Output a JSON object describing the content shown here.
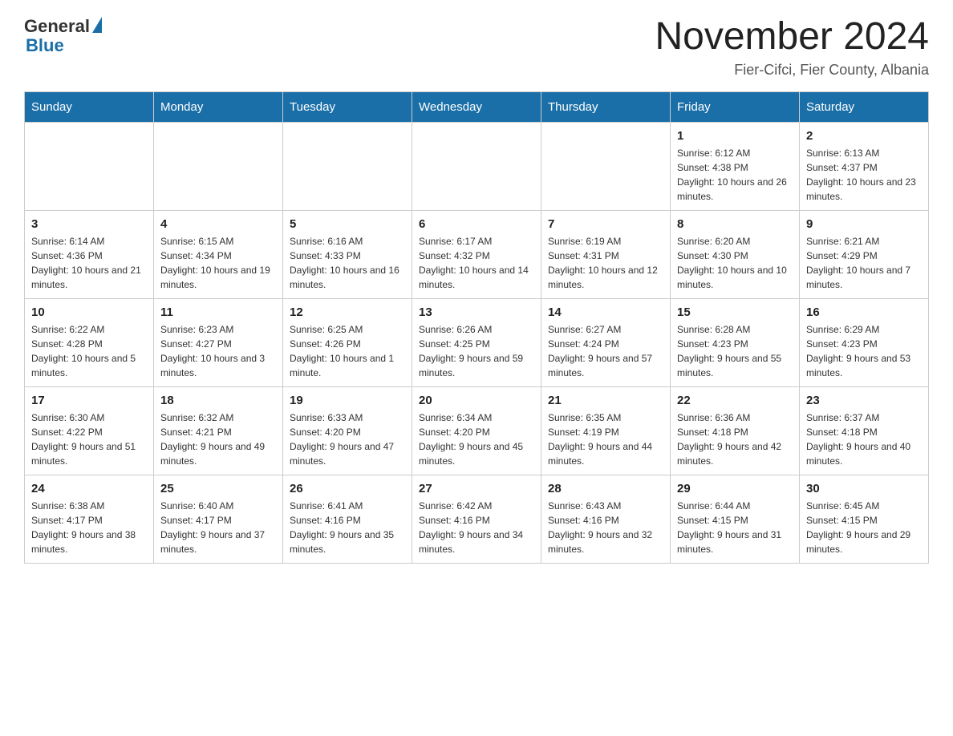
{
  "header": {
    "logo": {
      "general": "General",
      "blue": "Blue"
    },
    "title": "November 2024",
    "location": "Fier-Cifci, Fier County, Albania"
  },
  "calendar": {
    "days_of_week": [
      "Sunday",
      "Monday",
      "Tuesday",
      "Wednesday",
      "Thursday",
      "Friday",
      "Saturday"
    ],
    "weeks": [
      [
        {
          "day": "",
          "info": ""
        },
        {
          "day": "",
          "info": ""
        },
        {
          "day": "",
          "info": ""
        },
        {
          "day": "",
          "info": ""
        },
        {
          "day": "",
          "info": ""
        },
        {
          "day": "1",
          "info": "Sunrise: 6:12 AM\nSunset: 4:38 PM\nDaylight: 10 hours and 26 minutes."
        },
        {
          "day": "2",
          "info": "Sunrise: 6:13 AM\nSunset: 4:37 PM\nDaylight: 10 hours and 23 minutes."
        }
      ],
      [
        {
          "day": "3",
          "info": "Sunrise: 6:14 AM\nSunset: 4:36 PM\nDaylight: 10 hours and 21 minutes."
        },
        {
          "day": "4",
          "info": "Sunrise: 6:15 AM\nSunset: 4:34 PM\nDaylight: 10 hours and 19 minutes."
        },
        {
          "day": "5",
          "info": "Sunrise: 6:16 AM\nSunset: 4:33 PM\nDaylight: 10 hours and 16 minutes."
        },
        {
          "day": "6",
          "info": "Sunrise: 6:17 AM\nSunset: 4:32 PM\nDaylight: 10 hours and 14 minutes."
        },
        {
          "day": "7",
          "info": "Sunrise: 6:19 AM\nSunset: 4:31 PM\nDaylight: 10 hours and 12 minutes."
        },
        {
          "day": "8",
          "info": "Sunrise: 6:20 AM\nSunset: 4:30 PM\nDaylight: 10 hours and 10 minutes."
        },
        {
          "day": "9",
          "info": "Sunrise: 6:21 AM\nSunset: 4:29 PM\nDaylight: 10 hours and 7 minutes."
        }
      ],
      [
        {
          "day": "10",
          "info": "Sunrise: 6:22 AM\nSunset: 4:28 PM\nDaylight: 10 hours and 5 minutes."
        },
        {
          "day": "11",
          "info": "Sunrise: 6:23 AM\nSunset: 4:27 PM\nDaylight: 10 hours and 3 minutes."
        },
        {
          "day": "12",
          "info": "Sunrise: 6:25 AM\nSunset: 4:26 PM\nDaylight: 10 hours and 1 minute."
        },
        {
          "day": "13",
          "info": "Sunrise: 6:26 AM\nSunset: 4:25 PM\nDaylight: 9 hours and 59 minutes."
        },
        {
          "day": "14",
          "info": "Sunrise: 6:27 AM\nSunset: 4:24 PM\nDaylight: 9 hours and 57 minutes."
        },
        {
          "day": "15",
          "info": "Sunrise: 6:28 AM\nSunset: 4:23 PM\nDaylight: 9 hours and 55 minutes."
        },
        {
          "day": "16",
          "info": "Sunrise: 6:29 AM\nSunset: 4:23 PM\nDaylight: 9 hours and 53 minutes."
        }
      ],
      [
        {
          "day": "17",
          "info": "Sunrise: 6:30 AM\nSunset: 4:22 PM\nDaylight: 9 hours and 51 minutes."
        },
        {
          "day": "18",
          "info": "Sunrise: 6:32 AM\nSunset: 4:21 PM\nDaylight: 9 hours and 49 minutes."
        },
        {
          "day": "19",
          "info": "Sunrise: 6:33 AM\nSunset: 4:20 PM\nDaylight: 9 hours and 47 minutes."
        },
        {
          "day": "20",
          "info": "Sunrise: 6:34 AM\nSunset: 4:20 PM\nDaylight: 9 hours and 45 minutes."
        },
        {
          "day": "21",
          "info": "Sunrise: 6:35 AM\nSunset: 4:19 PM\nDaylight: 9 hours and 44 minutes."
        },
        {
          "day": "22",
          "info": "Sunrise: 6:36 AM\nSunset: 4:18 PM\nDaylight: 9 hours and 42 minutes."
        },
        {
          "day": "23",
          "info": "Sunrise: 6:37 AM\nSunset: 4:18 PM\nDaylight: 9 hours and 40 minutes."
        }
      ],
      [
        {
          "day": "24",
          "info": "Sunrise: 6:38 AM\nSunset: 4:17 PM\nDaylight: 9 hours and 38 minutes."
        },
        {
          "day": "25",
          "info": "Sunrise: 6:40 AM\nSunset: 4:17 PM\nDaylight: 9 hours and 37 minutes."
        },
        {
          "day": "26",
          "info": "Sunrise: 6:41 AM\nSunset: 4:16 PM\nDaylight: 9 hours and 35 minutes."
        },
        {
          "day": "27",
          "info": "Sunrise: 6:42 AM\nSunset: 4:16 PM\nDaylight: 9 hours and 34 minutes."
        },
        {
          "day": "28",
          "info": "Sunrise: 6:43 AM\nSunset: 4:16 PM\nDaylight: 9 hours and 32 minutes."
        },
        {
          "day": "29",
          "info": "Sunrise: 6:44 AM\nSunset: 4:15 PM\nDaylight: 9 hours and 31 minutes."
        },
        {
          "day": "30",
          "info": "Sunrise: 6:45 AM\nSunset: 4:15 PM\nDaylight: 9 hours and 29 minutes."
        }
      ]
    ]
  }
}
